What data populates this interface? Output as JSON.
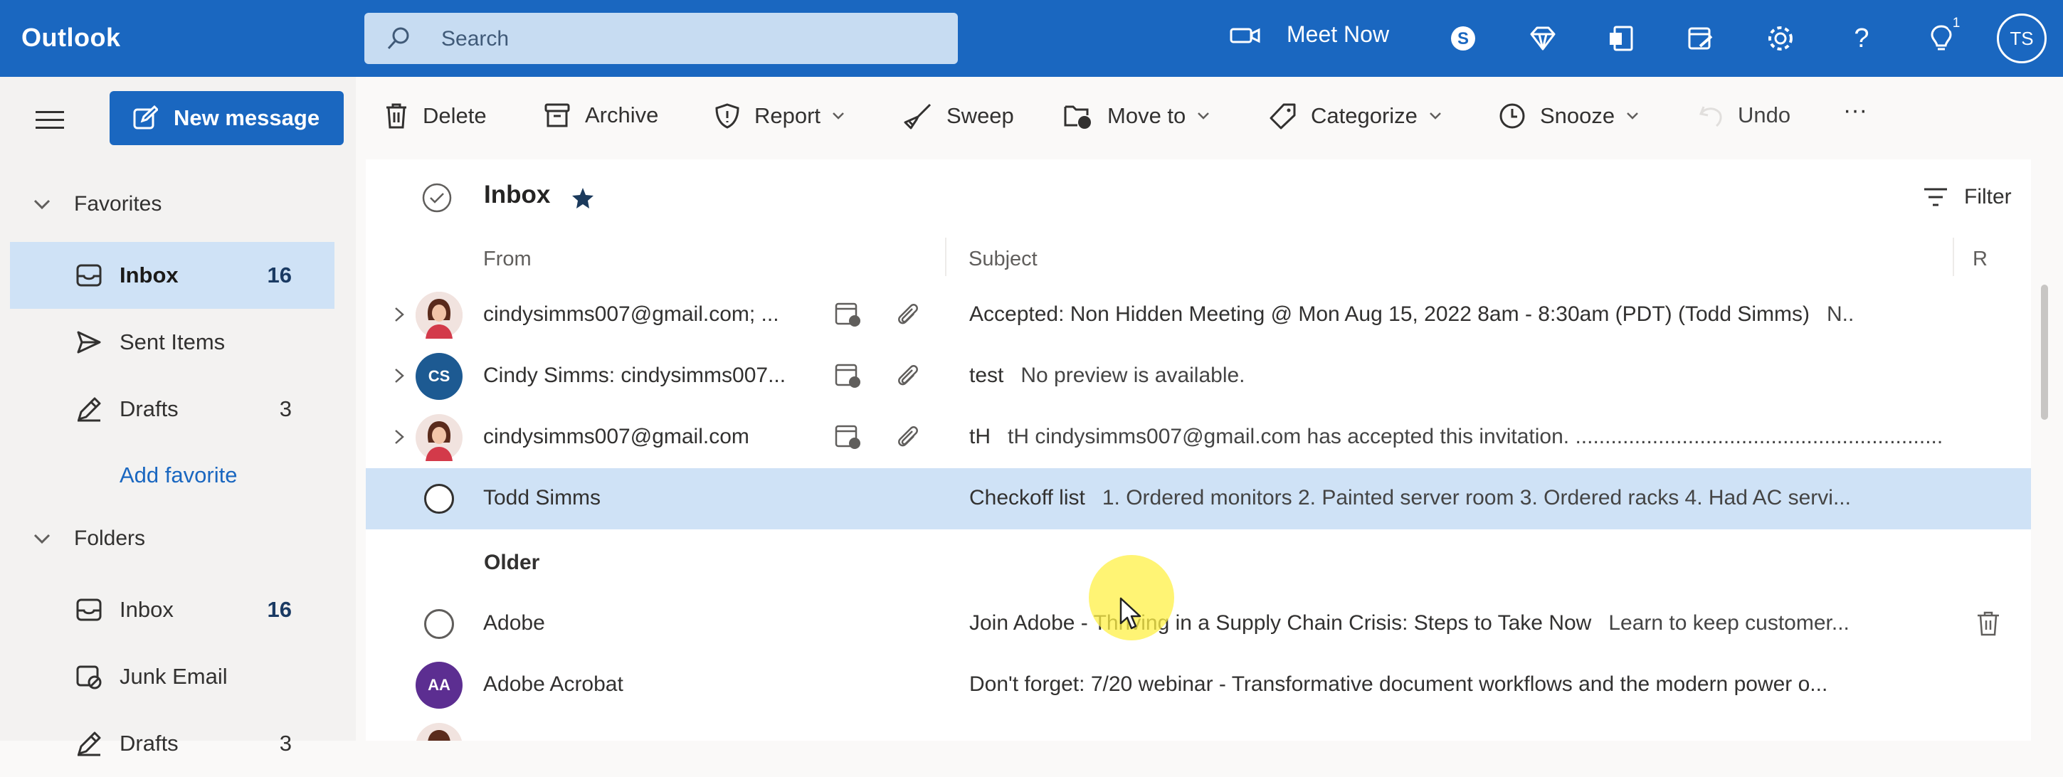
{
  "app": {
    "title": "Outlook",
    "brand_color": "#1a67c0"
  },
  "search": {
    "placeholder": "Search"
  },
  "topbar": {
    "meet_now_label": "Meet Now",
    "notification_count": "1",
    "user_initials": "TS",
    "icons": [
      "video-icon",
      "skype-icon",
      "premium-diamond-icon",
      "office-apps-icon",
      "my-day-icon",
      "settings-gear-icon",
      "help-icon",
      "tips-lightbulb-icon"
    ]
  },
  "leftnav": {
    "new_message_label": "New message",
    "favorites_label": "Favorites",
    "favorites": [
      {
        "label": "Inbox",
        "count": "16",
        "icon": "inbox-icon"
      },
      {
        "label": "Sent Items",
        "count": "",
        "icon": "send-icon"
      },
      {
        "label": "Drafts",
        "count": "3",
        "icon": "pencil-icon"
      }
    ],
    "add_favorite_label": "Add favorite",
    "folders_label": "Folders",
    "folders": [
      {
        "label": "Inbox",
        "count": "16",
        "icon": "inbox-icon"
      },
      {
        "label": "Junk Email",
        "count": "",
        "icon": "junk-icon"
      },
      {
        "label": "Drafts",
        "count": "3",
        "icon": "pencil-icon"
      }
    ]
  },
  "toolbar": {
    "delete": "Delete",
    "archive": "Archive",
    "report": "Report",
    "sweep": "Sweep",
    "move_to": "Move to",
    "categorize": "Categorize",
    "snooze": "Snooze",
    "undo": "Undo",
    "more": "···"
  },
  "list": {
    "title": "Inbox",
    "filter_label": "Filter",
    "columns": {
      "from": "From",
      "subject": "Subject",
      "received": "R"
    },
    "group_older": "Older",
    "messages": [
      {
        "from": "cindysimms007@gmail.com; ...",
        "subject": "Accepted: Non Hidden Meeting @ Mon Aug 15, 2022 8am - 8:30am (PDT) (Todd Simms)",
        "preview": "N..",
        "avatar": "photo"
      },
      {
        "from": "Cindy Simms: cindysimms007...",
        "subject": "test",
        "preview": "No preview is available.",
        "avatar": "CS",
        "avatar_color": "#1d5a92"
      },
      {
        "from": "cindysimms007@gmail.com",
        "subject": "tH",
        "preview": "tH cindysimms007@gmail.com has accepted this invitation. ..............................................................",
        "avatar": "photo"
      },
      {
        "from": "Todd Simms",
        "subject": "Checkoff list",
        "preview": "1. Ordered monitors 2. Painted server room 3. Ordered racks 4. Had AC servi...",
        "avatar": ""
      },
      {
        "from": "Adobe",
        "subject": "Join Adobe - Thriving in a Supply Chain Crisis: Steps to Take Now",
        "preview": "Learn to keep customer...",
        "avatar": ""
      },
      {
        "from": "Adobe Acrobat",
        "subject": "Don't forget: 7/20 webinar - Transformative document workflows and the modern power o...",
        "preview": "",
        "avatar": "AA",
        "avatar_color": "#5c2e91"
      }
    ]
  }
}
